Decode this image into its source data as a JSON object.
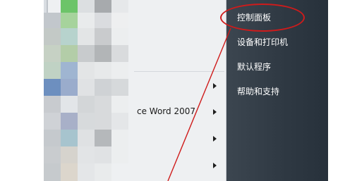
{
  "start_menu": {
    "left_pane": {
      "recent_item_label": "ce Word 2007"
    },
    "right_pane": {
      "items": [
        {
          "label": "控制面板"
        },
        {
          "label": "设备和打印机"
        },
        {
          "label": "默认程序"
        },
        {
          "label": "帮助和支持"
        }
      ]
    }
  },
  "colors": {
    "left_pane": "#eef0f2",
    "right_pane": "#2f3943",
    "annotation": "#cf1b1b"
  }
}
